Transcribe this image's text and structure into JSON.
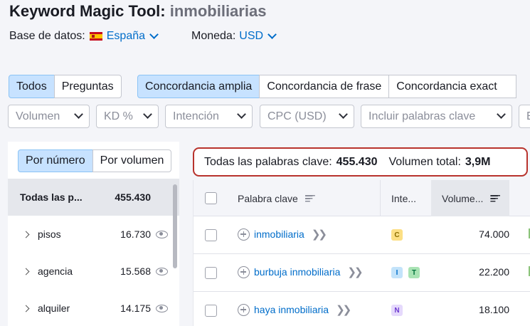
{
  "header": {
    "tool_name": "Keyword Magic Tool:",
    "query": "inmobiliarias",
    "database_label": "Base de datos:",
    "database_value": "España",
    "currency_label": "Moneda:",
    "currency_value": "USD"
  },
  "question_tabs": [
    {
      "label": "Todos",
      "selected": true
    },
    {
      "label": "Preguntas",
      "selected": false
    }
  ],
  "match_tabs": [
    {
      "label": "Concordancia amplia",
      "selected": true
    },
    {
      "label": "Concordancia de frase",
      "selected": false
    },
    {
      "label": "Concordancia exact",
      "selected": false
    }
  ],
  "filters": [
    {
      "label": "Volumen"
    },
    {
      "label": "KD %"
    },
    {
      "label": "Intención"
    },
    {
      "label": "CPC (USD)"
    },
    {
      "label": "Incluir palabras clave"
    },
    {
      "label": "E"
    }
  ],
  "groups_panel": {
    "tabs": [
      {
        "label": "Por número",
        "selected": true
      },
      {
        "label": "Por volumen",
        "selected": false
      }
    ],
    "rows": [
      {
        "name": "Todas las p...",
        "count": "455.430",
        "header": true
      },
      {
        "name": "pisos",
        "count": "16.730"
      },
      {
        "name": "agencia",
        "count": "15.568"
      },
      {
        "name": "alquiler",
        "count": "14.175"
      }
    ]
  },
  "summary": {
    "all_keywords_label": "Todas las palabras clave:",
    "all_keywords_value": "455.430",
    "total_volume_label": "Volumen total:",
    "total_volume_value": "3,9M"
  },
  "table": {
    "columns": {
      "keyword": "Palabra clave",
      "intent": "Inte...",
      "volume": "Volume..."
    },
    "rows": [
      {
        "keyword": "inmobiliaria",
        "intents": [
          {
            "code": "C",
            "bg": "#fcdf84",
            "fg": "#8a6d00"
          }
        ],
        "volume": "74.000"
      },
      {
        "keyword": "burbuja inmobiliaria",
        "intents": [
          {
            "code": "I",
            "bg": "#c3e3fa",
            "fg": "#006dca"
          },
          {
            "code": "T",
            "bg": "#a9e3b4",
            "fg": "#00723b"
          }
        ],
        "volume": "22.200"
      },
      {
        "keyword": "haya inmobiliaria",
        "intents": [
          {
            "code": "N",
            "bg": "#e5d9fc",
            "fg": "#6e3ad0"
          }
        ],
        "volume": "18.100"
      }
    ]
  },
  "colors": {
    "accent": "#006dca",
    "selected_tab": "#c7e2ff",
    "highlight_border": "#b8332d"
  }
}
